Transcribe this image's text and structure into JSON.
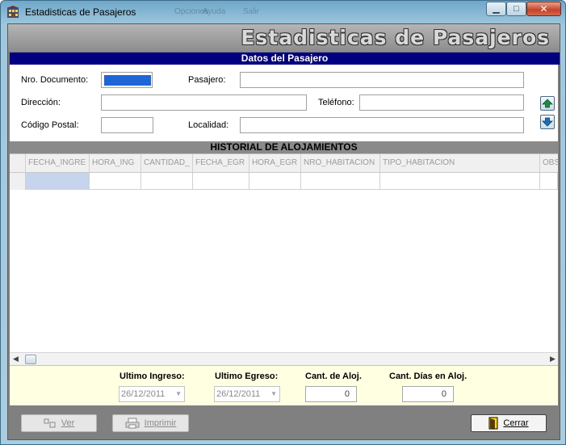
{
  "window": {
    "title": "Estadisticas de Pasajeros",
    "ghost_menu": [
      "Opciones",
      "Ayuda",
      "Salir"
    ]
  },
  "banner": {
    "title": "Estadisticas de Pasajeros"
  },
  "passenger_section": {
    "title": "Datos del Pasajero",
    "labels": {
      "documento": "Nro. Documento:",
      "pasajero": "Pasajero:",
      "direccion": "Dirección:",
      "telefono": "Teléfono:",
      "codigo_postal": "Código Postal:",
      "localidad": "Localidad:"
    },
    "values": {
      "documento": "",
      "pasajero": "",
      "direccion": "",
      "telefono": "",
      "codigo_postal": "",
      "localidad": ""
    }
  },
  "history_section": {
    "title": "HISTORIAL DE ALOJAMIENTOS",
    "columns": [
      "FECHA_INGRE",
      "HORA_ING",
      "CANTIDAD_",
      "FECHA_EGR",
      "HORA_EGR",
      "NRO_HABITACION",
      "TIPO_HABITACION",
      "OBSERV"
    ]
  },
  "stats": {
    "ultimo_ingreso_label": "Ultimo Ingreso:",
    "ultimo_ingreso_value": "26/12/2011",
    "ultimo_egreso_label": "Ultimo Egreso:",
    "ultimo_egreso_value": "26/12/2011",
    "cant_aloj_label": "Cant. de Aloj.",
    "cant_aloj_value": "0",
    "cant_dias_label": "Cant. Días en Aloj.",
    "cant_dias_value": "0"
  },
  "footer": {
    "ver_label": "Ver",
    "imprimir_label": "Imprimir",
    "cerrar_label": "Cerrar"
  },
  "icons": {
    "up": "arrow-up-icon",
    "down": "arrow-down-icon",
    "ver": "view-icon",
    "imprimir": "printer-icon",
    "cerrar": "exit-door-icon"
  },
  "colors": {
    "section_head_blue": "#000080",
    "stats_bg": "#ffffe1",
    "client_grey": "#808080"
  }
}
